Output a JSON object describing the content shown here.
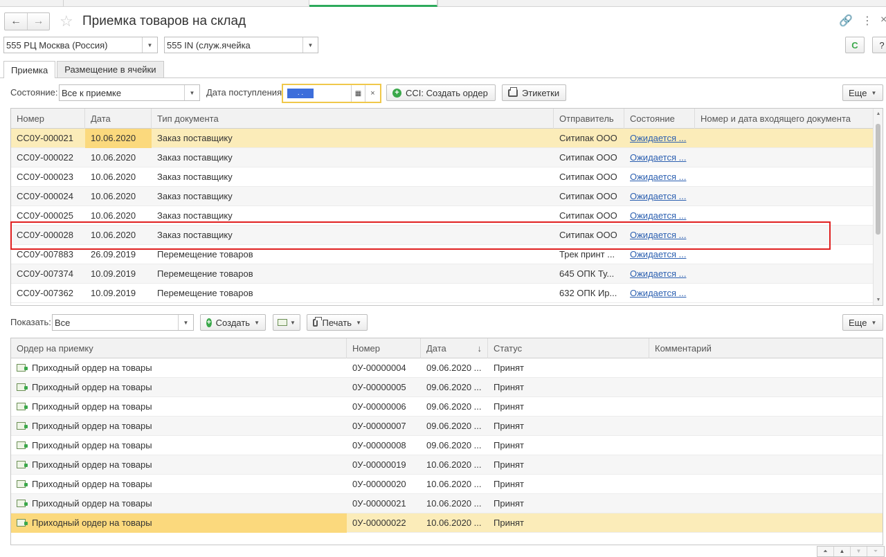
{
  "window": {
    "title": "Приемка товаров на склад",
    "back_icon": "←",
    "forward_icon": "→",
    "favorite_icon": "☆",
    "link_icon": "🔗",
    "menu_icon": "⋮",
    "close_icon": "×",
    "refresh_icon": "C",
    "help_icon": "?"
  },
  "filters": {
    "warehouse": "555 РЦ Москва (Россия)",
    "cell": "555 IN (служ.ячейка"
  },
  "tabs": [
    {
      "label": "Приемка",
      "active": true
    },
    {
      "label": "Размещение в ячейки",
      "active": false
    }
  ],
  "toolbar1": {
    "state_label": "Состояние:",
    "state_value": "Все к приемке",
    "date_label": "Дата поступления:",
    "date_selected": ". .",
    "create_order_label": "CCI: Создать ордер",
    "labels_label": "Этикетки",
    "more_label": "Еще"
  },
  "grid1": {
    "columns": [
      "Номер",
      "Дата",
      "Тип документа",
      "Отправитель",
      "Состояние",
      "Номер и дата входящего документа"
    ],
    "rows": [
      {
        "num": "СС0У-000021",
        "date": "10.06.2020",
        "type": "Заказ поставщику",
        "sender": "Ситипак ООО",
        "state": "Ожидается ..."
      },
      {
        "num": "СС0У-000022",
        "date": "10.06.2020",
        "type": "Заказ поставщику",
        "sender": "Ситипак ООО",
        "state": "Ожидается ..."
      },
      {
        "num": "СС0У-000023",
        "date": "10.06.2020",
        "type": "Заказ поставщику",
        "sender": "Ситипак ООО",
        "state": "Ожидается ..."
      },
      {
        "num": "СС0У-000024",
        "date": "10.06.2020",
        "type": "Заказ поставщику",
        "sender": "Ситипак ООО",
        "state": "Ожидается ..."
      },
      {
        "num": "СС0У-000025",
        "date": "10.06.2020",
        "type": "Заказ поставщику",
        "sender": "Ситипак ООО",
        "state": "Ожидается ..."
      },
      {
        "num": "СС0У-000028",
        "date": "10.06.2020",
        "type": "Заказ поставщику",
        "sender": "Ситипак ООО",
        "state": "Ожидается ..."
      },
      {
        "num": "СС0У-007883",
        "date": "26.09.2019",
        "type": "Перемещение товаров",
        "sender": "Трек принт ...",
        "state": "Ожидается ..."
      },
      {
        "num": "СС0У-007374",
        "date": "10.09.2019",
        "type": "Перемещение товаров",
        "sender": "645 ОПК Ту...",
        "state": "Ожидается ..."
      },
      {
        "num": "СС0У-007362",
        "date": "10.09.2019",
        "type": "Перемещение товаров",
        "sender": "632 ОПК Ир...",
        "state": "Ожидается ..."
      }
    ]
  },
  "toolbar2": {
    "show_label": "Показать:",
    "show_value": "Все",
    "create_label": "Создать",
    "print_label": "Печать",
    "more_label": "Еще"
  },
  "grid2": {
    "columns": [
      "Ордер на приемку",
      "Номер",
      "Дата",
      "Статус",
      "Комментарий"
    ],
    "sort_icon": "↓",
    "rows": [
      {
        "order": "Приходный ордер на товары",
        "num": "0У-00000004",
        "date": "09.06.2020 ...",
        "status": "Принят"
      },
      {
        "order": "Приходный ордер на товары",
        "num": "0У-00000005",
        "date": "09.06.2020 ...",
        "status": "Принят"
      },
      {
        "order": "Приходный ордер на товары",
        "num": "0У-00000006",
        "date": "09.06.2020 ...",
        "status": "Принят"
      },
      {
        "order": "Приходный ордер на товары",
        "num": "0У-00000007",
        "date": "09.06.2020 ...",
        "status": "Принят"
      },
      {
        "order": "Приходный ордер на товары",
        "num": "0У-00000008",
        "date": "09.06.2020 ...",
        "status": "Принят"
      },
      {
        "order": "Приходный ордер на товары",
        "num": "0У-00000019",
        "date": "10.06.2020 ...",
        "status": "Принят"
      },
      {
        "order": "Приходный ордер на товары",
        "num": "0У-00000020",
        "date": "10.06.2020 ...",
        "status": "Принят"
      },
      {
        "order": "Приходный ордер на товары",
        "num": "0У-00000021",
        "date": "10.06.2020 ...",
        "status": "Принят"
      },
      {
        "order": "Приходный ордер на товары",
        "num": "0У-00000022",
        "date": "10.06.2020 ...",
        "status": "Принят"
      }
    ]
  },
  "colors": {
    "selected_row": "#fbecb9",
    "selected_cell": "#fbd97d",
    "link": "#2b5fb0",
    "accent_green": "#3aa84a",
    "annotation_red": "#e02020"
  }
}
